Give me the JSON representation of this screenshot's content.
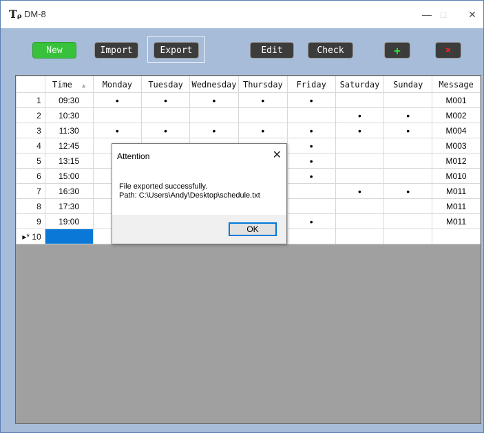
{
  "window": {
    "icon_glyph": "Tᵨ",
    "title": "DM-8",
    "minimize_glyph": "—",
    "maximize_glyph": "□",
    "close_glyph": "✕"
  },
  "toolbar": {
    "new_label": "New",
    "import_label": "Import",
    "export_label": "Export",
    "edit_label": "Edit",
    "check_label": "Check",
    "add_glyph": "+",
    "delete_glyph": "×"
  },
  "table": {
    "headers": [
      "Time",
      "Monday",
      "Tuesday",
      "Wednesday",
      "Thursday",
      "Friday",
      "Saturday",
      "Sunday",
      "Message"
    ],
    "sort_arrow": "▲",
    "rows": [
      {
        "num": "1",
        "time": "09:30",
        "days": [
          "•",
          "•",
          "•",
          "•",
          "•",
          "",
          ""
        ],
        "msg": "M001"
      },
      {
        "num": "2",
        "time": "10:30",
        "days": [
          "",
          "",
          "",
          "",
          "",
          "•",
          "•"
        ],
        "msg": "M002"
      },
      {
        "num": "3",
        "time": "11:30",
        "days": [
          "•",
          "•",
          "•",
          "•",
          "•",
          "•",
          "•"
        ],
        "msg": "M004"
      },
      {
        "num": "4",
        "time": "12:45",
        "days": [
          "",
          "",
          "",
          "",
          "•",
          "",
          ""
        ],
        "msg": "M003"
      },
      {
        "num": "5",
        "time": "13:15",
        "days": [
          "",
          "",
          "",
          "",
          "•",
          "",
          ""
        ],
        "msg": "M012"
      },
      {
        "num": "6",
        "time": "15:00",
        "days": [
          "",
          "",
          "",
          "",
          "•",
          "",
          ""
        ],
        "msg": "M010"
      },
      {
        "num": "7",
        "time": "16:30",
        "days": [
          "",
          "",
          "",
          "",
          "",
          "•",
          "•"
        ],
        "msg": "M011"
      },
      {
        "num": "8",
        "time": "17:30",
        "days": [
          "",
          "",
          "",
          "",
          "",
          "",
          ""
        ],
        "msg": "M011"
      },
      {
        "num": "9",
        "time": "19:00",
        "days": [
          "",
          "",
          "",
          "",
          "•",
          "",
          ""
        ],
        "msg": "M011"
      }
    ],
    "new_row": {
      "marker": "▸* 10"
    }
  },
  "dialog": {
    "title": "Attention",
    "close_glyph": "✕",
    "line1": "File exported successfully.",
    "line2": "Path: C:\\Users\\Andy\\Desktop\\schedule.txt",
    "ok_label": "OK"
  }
}
